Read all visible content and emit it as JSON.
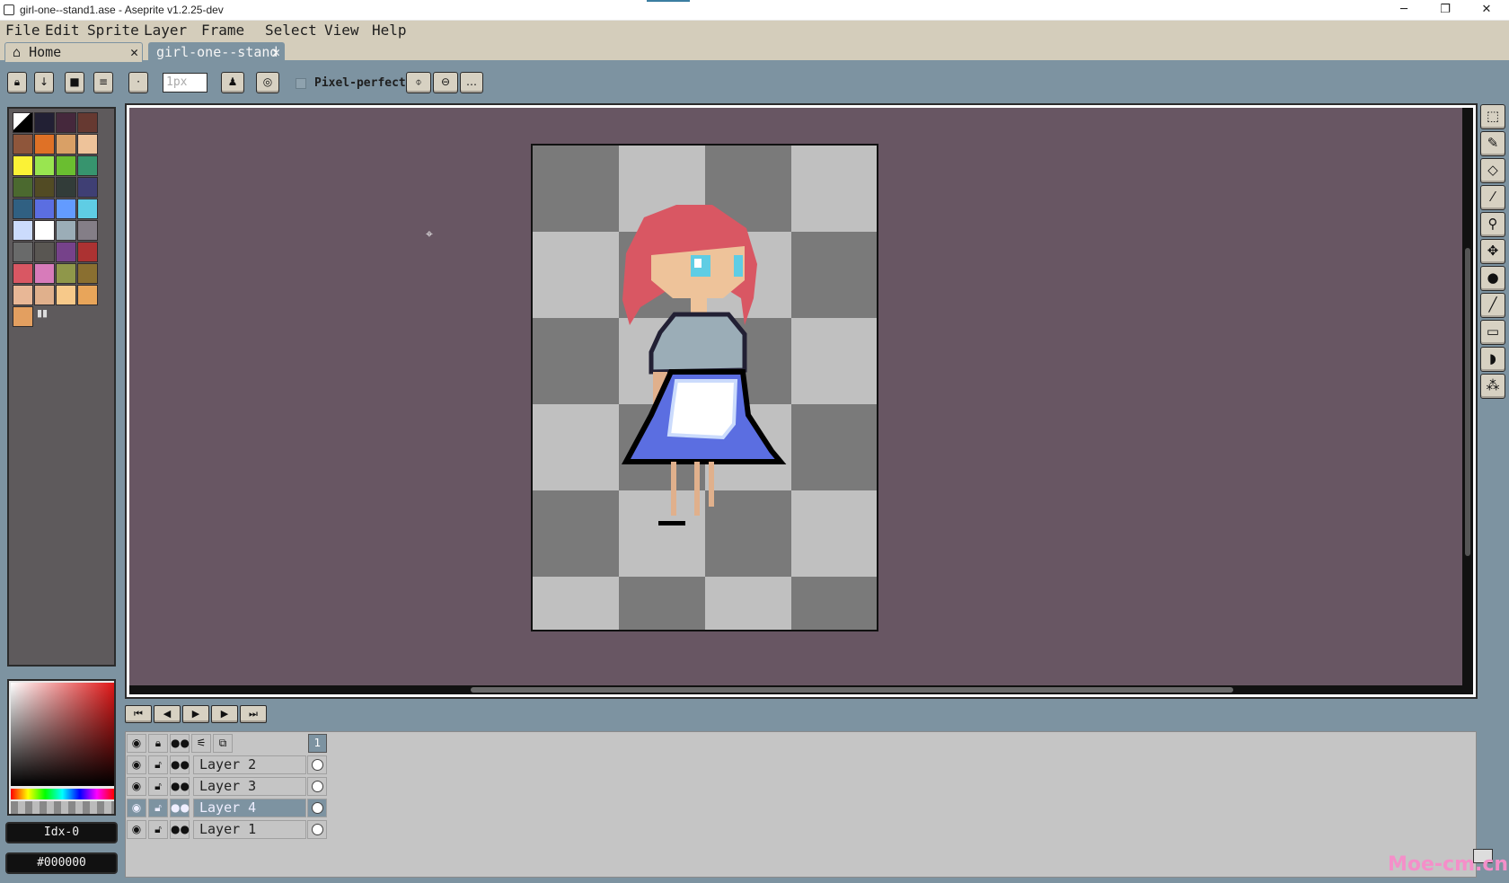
{
  "window": {
    "title": "girl-one--stand1.ase - Aseprite v1.2.25-dev",
    "minimize": "─",
    "restore": "❐",
    "close": "✕"
  },
  "menu": [
    "File",
    "Edit",
    "Sprite",
    "Layer",
    "Frame",
    "Select",
    "View",
    "Help"
  ],
  "tabs": {
    "home": {
      "label": "Home",
      "close": "✕"
    },
    "document": {
      "label": "girl-one--stand",
      "close": "✕"
    }
  },
  "context_bar": {
    "brush_size": "1px",
    "pixel_perfect_label": "Pixel-perfect",
    "pixel_perfect_checked": false,
    "more": "…"
  },
  "palette": {
    "colors": [
      "#000000",
      "#222034",
      "#45283c",
      "#663931",
      "#8f563b",
      "#df7126",
      "#d9a066",
      "#eec39a",
      "#fbf236",
      "#99e550",
      "#6abe30",
      "#37946e",
      "#4b692f",
      "#524b24",
      "#323c39",
      "#3f3f74",
      "#306082",
      "#5b6ee1",
      "#639bff",
      "#5fcde4",
      "#cbdbfc",
      "#ffffff",
      "#9badb7",
      "#847e87",
      "#696a6a",
      "#595652",
      "#76428a",
      "#ac3232",
      "#d95763",
      "#d77bba",
      "#8f974a",
      "#8a6f30",
      "#e8b796",
      "#e0b08c",
      "#f7c98a",
      "#e8a55a",
      "#e39f60"
    ]
  },
  "color_picker": {
    "index_label": "Idx-0",
    "hex": "#000000"
  },
  "playback": {
    "first": "⏮",
    "prev": "◀",
    "play": "▶",
    "next": "▶",
    "last": "⏭"
  },
  "timeline": {
    "frame_number": "1",
    "layers": [
      {
        "name": "Layer 2",
        "selected": false
      },
      {
        "name": "Layer 3",
        "selected": false
      },
      {
        "name": "Layer 4",
        "selected": true
      },
      {
        "name": "Layer 1",
        "selected": false
      }
    ]
  },
  "watermark": "Moe-cm.cn"
}
